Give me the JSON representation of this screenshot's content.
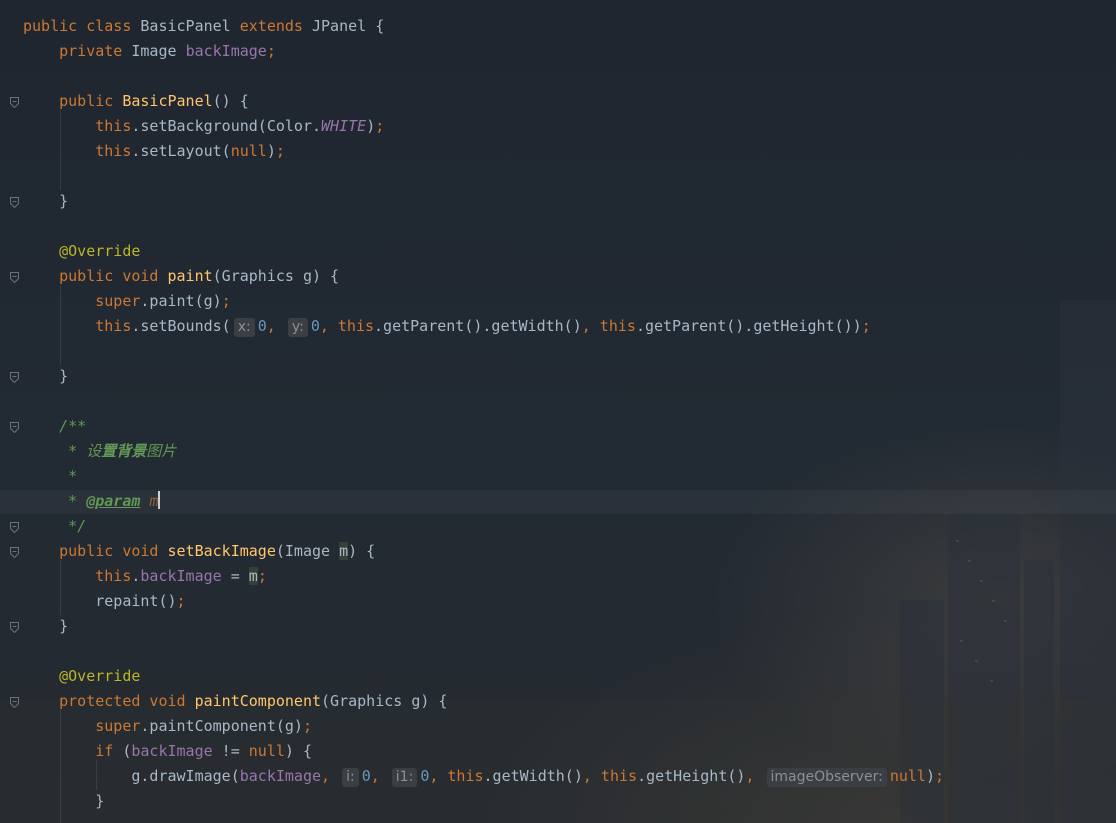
{
  "editor": {
    "lines": [
      {
        "t": 14,
        "segs": [
          [
            "kw",
            "public class "
          ],
          [
            "pl",
            "BasicPanel "
          ],
          [
            "kw",
            "extends "
          ],
          [
            "pl",
            "JPanel {"
          ]
        ]
      },
      {
        "t": 39,
        "segs": [
          [
            "kw",
            "    private "
          ],
          [
            "pl",
            "Image "
          ],
          [
            "fld",
            "backImage"
          ],
          [
            "kw",
            ";"
          ]
        ]
      },
      {
        "t": 89,
        "segs": [
          [
            "kw",
            "    public "
          ],
          [
            "fn",
            "BasicPanel"
          ],
          [
            "pl",
            "() {"
          ]
        ]
      },
      {
        "t": 114,
        "segs": [
          [
            "kw",
            "        this"
          ],
          [
            "pl",
            ".setBackground(Color."
          ],
          [
            "st",
            "WHITE"
          ],
          [
            "pl",
            ")"
          ],
          [
            "kw",
            ";"
          ]
        ]
      },
      {
        "t": 139,
        "segs": [
          [
            "kw",
            "        this"
          ],
          [
            "pl",
            ".setLayout("
          ],
          [
            "kw",
            "null"
          ],
          [
            "pl",
            ")"
          ],
          [
            "kw",
            ";"
          ]
        ]
      },
      {
        "t": 189,
        "segs": [
          [
            "pl",
            "    }"
          ]
        ]
      },
      {
        "t": 239,
        "segs": [
          [
            "ann",
            "    @Override"
          ]
        ]
      },
      {
        "t": 264,
        "segs": [
          [
            "kw",
            "    public void "
          ],
          [
            "fn",
            "paint"
          ],
          [
            "pl",
            "(Graphics g) {"
          ]
        ]
      },
      {
        "t": 289,
        "segs": [
          [
            "kw",
            "        super"
          ],
          [
            "pl",
            ".paint(g)"
          ],
          [
            "kw",
            ";"
          ]
        ]
      },
      {
        "t": 314,
        "segs": [
          [
            "kw",
            "        this"
          ],
          [
            "pl",
            ".setBounds("
          ],
          [
            "hint",
            "x:"
          ],
          [
            "num",
            "0"
          ],
          [
            "kw",
            ", "
          ],
          [
            "hint",
            "y:"
          ],
          [
            "num",
            "0"
          ],
          [
            "kw",
            ", this"
          ],
          [
            "pl",
            ".getParent().getWidth()"
          ],
          [
            "kw",
            ", this"
          ],
          [
            "pl",
            ".getParent().getHeight())"
          ],
          [
            "kw",
            ";"
          ]
        ]
      },
      {
        "t": 364,
        "segs": [
          [
            "pl",
            "    }"
          ]
        ]
      },
      {
        "t": 414,
        "segs": [
          [
            "doc",
            "    /**"
          ]
        ]
      },
      {
        "t": 439,
        "segs": [
          [
            "doc",
            "     * 设"
          ],
          [
            "docb",
            "置背景"
          ],
          [
            "doc",
            "图片"
          ]
        ]
      },
      {
        "t": 464,
        "segs": [
          [
            "doc",
            "     *"
          ]
        ]
      },
      {
        "t": 489,
        "segs": [
          [
            "doc",
            "     * "
          ],
          [
            "doctag",
            "@param"
          ],
          [
            "doc",
            " "
          ],
          [
            "docval",
            "m"
          ],
          [
            "caret",
            ""
          ]
        ]
      },
      {
        "t": 514,
        "segs": [
          [
            "doc",
            "     */"
          ]
        ]
      },
      {
        "t": 539,
        "segs": [
          [
            "kw",
            "    public void "
          ],
          [
            "fn",
            "setBackImage"
          ],
          [
            "pl",
            "(Image "
          ],
          [
            "hl",
            "m"
          ],
          [
            "pl",
            ") {"
          ]
        ]
      },
      {
        "t": 564,
        "segs": [
          [
            "kw",
            "        this"
          ],
          [
            "pl",
            "."
          ],
          [
            "fld",
            "backImage"
          ],
          [
            "pl",
            " = "
          ],
          [
            "hl",
            "m"
          ],
          [
            "kw",
            ";"
          ]
        ]
      },
      {
        "t": 589,
        "segs": [
          [
            "pl",
            "        repaint()"
          ],
          [
            "kw",
            ";"
          ]
        ]
      },
      {
        "t": 614,
        "segs": [
          [
            "pl",
            "    }"
          ]
        ]
      },
      {
        "t": 664,
        "segs": [
          [
            "ann",
            "    @Override"
          ]
        ]
      },
      {
        "t": 689,
        "segs": [
          [
            "kw",
            "    protected void "
          ],
          [
            "fn",
            "paintComponent"
          ],
          [
            "pl",
            "(Graphics g) {"
          ]
        ]
      },
      {
        "t": 714,
        "segs": [
          [
            "kw",
            "        super"
          ],
          [
            "pl",
            ".paintComponent(g)"
          ],
          [
            "kw",
            ";"
          ]
        ]
      },
      {
        "t": 739,
        "segs": [
          [
            "kw",
            "        if "
          ],
          [
            "pl",
            "("
          ],
          [
            "fld",
            "backImage"
          ],
          [
            "pl",
            " != "
          ],
          [
            "kw",
            "null"
          ],
          [
            "pl",
            ") {"
          ]
        ]
      },
      {
        "t": 764,
        "segs": [
          [
            "pl",
            "            g.drawImage("
          ],
          [
            "fld",
            "backImage"
          ],
          [
            "kw",
            ", "
          ],
          [
            "hint",
            "i:"
          ],
          [
            "num",
            "0"
          ],
          [
            "kw",
            ", "
          ],
          [
            "hint",
            "i1:"
          ],
          [
            "num",
            "0"
          ],
          [
            "kw",
            ", this"
          ],
          [
            "pl",
            ".getWidth()"
          ],
          [
            "kw",
            ", this"
          ],
          [
            "pl",
            ".getHeight()"
          ],
          [
            "kw",
            ", "
          ],
          [
            "hint",
            "imageObserver:"
          ],
          [
            "kw",
            "null"
          ],
          [
            "pl",
            ")"
          ],
          [
            "kw",
            ";"
          ]
        ]
      },
      {
        "t": 789,
        "segs": [
          [
            "pl",
            "        }"
          ]
        ]
      }
    ],
    "fold_markers": [
      97,
      197,
      272,
      372,
      422,
      522,
      547,
      622,
      697
    ]
  }
}
